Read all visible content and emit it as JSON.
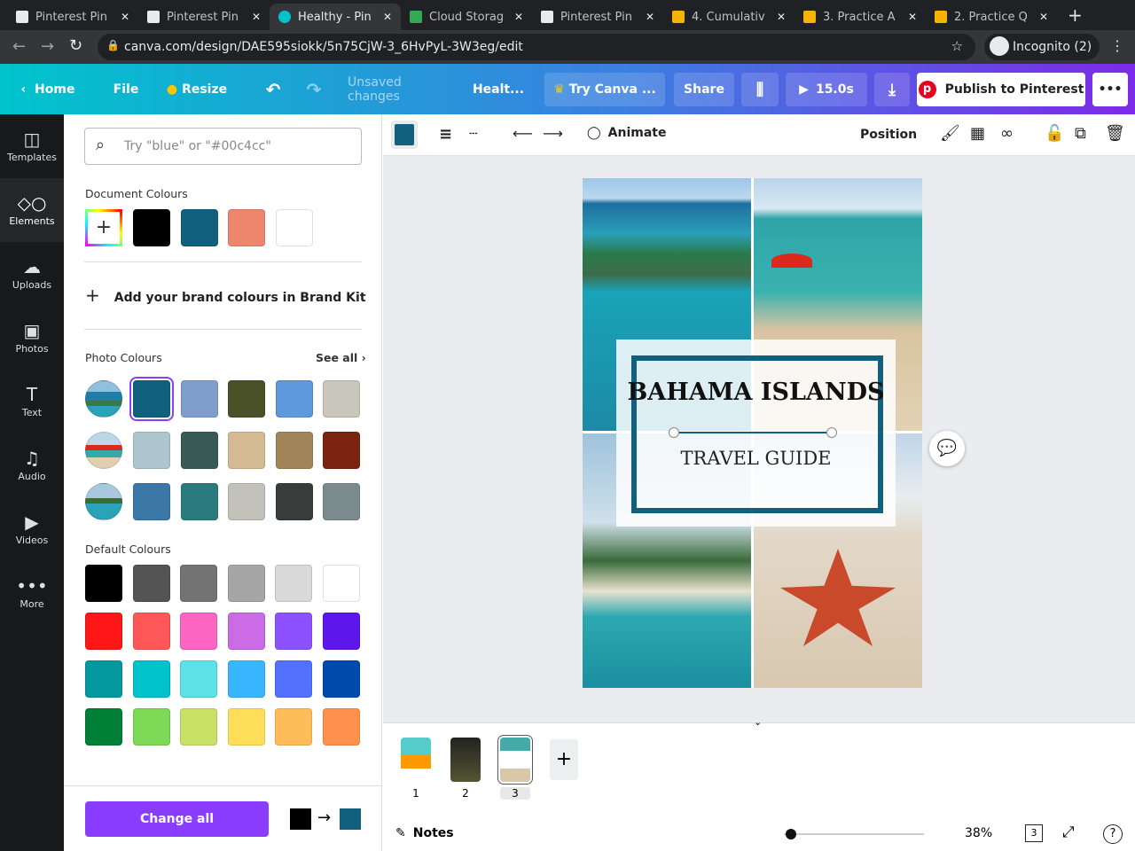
{
  "browser": {
    "tabs": [
      {
        "title": "Pinterest Pin",
        "icon": "pinterest-icon"
      },
      {
        "title": "Pinterest Pin",
        "icon": "pinterest-icon"
      },
      {
        "title": "Healthy - Pin",
        "icon": "canva-icon",
        "active": true
      },
      {
        "title": "Cloud Storag",
        "icon": "drive-icon"
      },
      {
        "title": "Pinterest Pin",
        "icon": "pinterest-icon"
      },
      {
        "title": "4. Cumulativ",
        "icon": "slides-icon"
      },
      {
        "title": "3. Practice A",
        "icon": "slides-icon"
      },
      {
        "title": "2. Practice Q",
        "icon": "slides-icon"
      }
    ],
    "url": "canva.com/design/DAE595siokk/5n75CjW-3_6HvPyL-3W3eg/edit",
    "incognito": "Incognito (2)"
  },
  "header": {
    "home": "Home",
    "file": "File",
    "resize": "Resize",
    "unsaved": "Unsaved changes",
    "title": "Healt...",
    "try": "Try Canva ...",
    "share": "Share",
    "duration": "15.0s",
    "publish": "Publish to Pinterest"
  },
  "rail": [
    {
      "label": "Templates",
      "icon": "◫"
    },
    {
      "label": "Elements",
      "icon": "◇○"
    },
    {
      "label": "Uploads",
      "icon": "☁"
    },
    {
      "label": "Photos",
      "icon": "▣"
    },
    {
      "label": "Text",
      "icon": "T"
    },
    {
      "label": "Audio",
      "icon": "♫"
    },
    {
      "label": "Videos",
      "icon": "▶"
    },
    {
      "label": "More",
      "icon": "•••"
    }
  ],
  "panel": {
    "search_placeholder": "Try \"blue\" or \"#00c4cc\"",
    "document_title": "Document Colours",
    "document_colours": [
      "#000000",
      "#10607e",
      "#ee866f",
      "#ffffff"
    ],
    "brand_kit": "Add your brand colours in Brand Kit",
    "photo_title": "Photo Colours",
    "see_all": "See all",
    "photo_rows": [
      [
        "#10607e",
        "#7f9ecb",
        "#4a5129",
        "#5d99db",
        "#c9c7bb"
      ],
      [
        "#adc5cf",
        "#3a5a56",
        "#d4ba92",
        "#a28459",
        "#7a2410"
      ],
      [
        "#3b77a7",
        "#2b7b7e",
        "#c2c2ba",
        "#383d3c",
        "#7b8b8d"
      ]
    ],
    "default_title": "Default Colours",
    "default_colours": [
      "#000000",
      "#545454",
      "#737373",
      "#a6a6a6",
      "#d9d9d9",
      "#ffffff",
      "#ff1616",
      "#ff5757",
      "#ff66c4",
      "#cb6ce6",
      "#8c52ff",
      "#5e17eb",
      "#03989e",
      "#00c2cb",
      "#5ce1e6",
      "#38b6ff",
      "#5271ff",
      "#004aad",
      "#008037",
      "#7ed957",
      "#c9e265",
      "#ffde59",
      "#ffbd59",
      "#ff914d"
    ],
    "change_all": "Change all",
    "from_colour": "#000000",
    "to_colour": "#10607e"
  },
  "toolbar": {
    "animate": "Animate",
    "position": "Position",
    "colour": "#10607e"
  },
  "design": {
    "title": "BAHAMA ISLANDS",
    "subtitle": "TRAVEL GUIDE"
  },
  "footer": {
    "pages": [
      "1",
      "2",
      "3"
    ],
    "notes": "Notes",
    "zoom": "38%",
    "page_count": "3",
    "zoom_fraction": 0.05
  }
}
